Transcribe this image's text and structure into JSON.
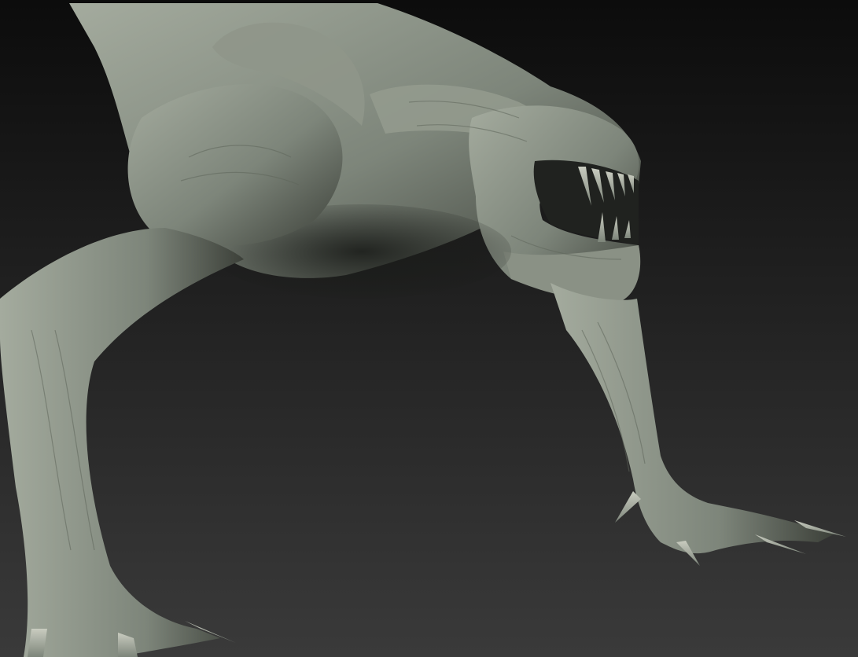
{
  "viewport": {
    "background_top": "#0c0c0c",
    "background_bottom": "#3a3a3a"
  },
  "model": {
    "subject": "creature-sculpt",
    "skin_light": "#a4ab9e",
    "skin_mid": "#7d857a",
    "skin_dark": "#3c4039",
    "shadow": "#1a1c19",
    "tooth": "#c9ccc0",
    "mouth_interior": "#20221f"
  }
}
